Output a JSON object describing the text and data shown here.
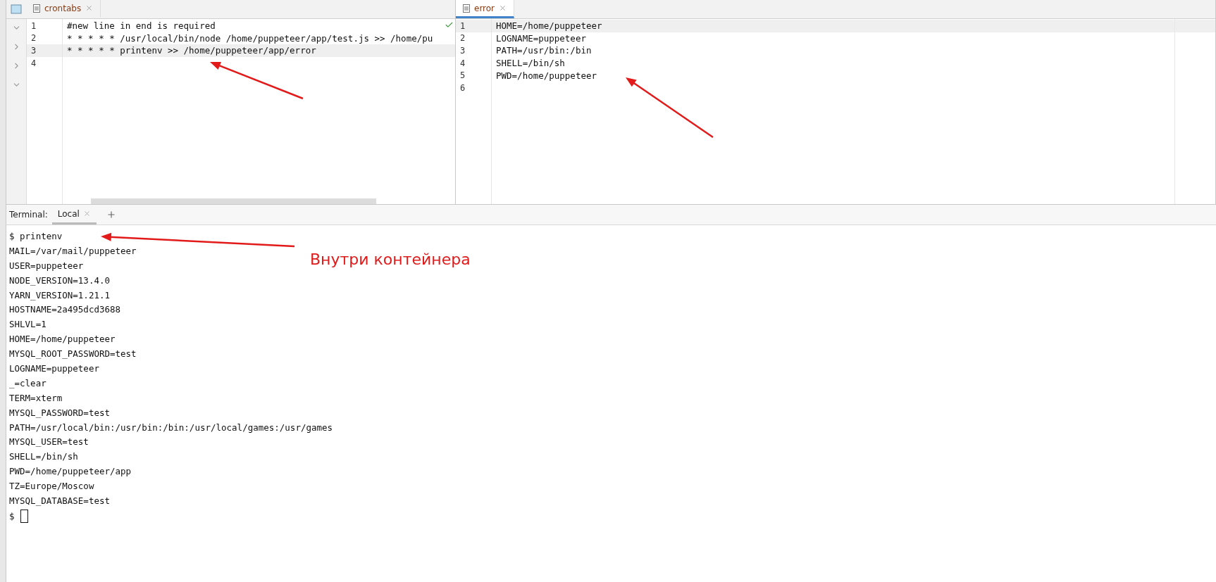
{
  "editors": [
    {
      "tab": {
        "label": "crontabs",
        "selected": false
      },
      "status_ok": true,
      "lines": [
        {
          "number": "1",
          "text": "#new line in end is required",
          "current": false
        },
        {
          "number": "2",
          "text": "* * * * * /usr/local/bin/node /home/puppeteer/app/test.js >> /home/pu",
          "current": false
        },
        {
          "number": "3",
          "text": "* * * * * printenv >> /home/puppeteer/app/error",
          "current": true
        },
        {
          "number": "4",
          "current": false
        }
      ]
    },
    {
      "tab": {
        "label": "error",
        "selected": true
      },
      "status_ok": false,
      "lines": [
        {
          "number": "1",
          "text": "HOME=/home/puppeteer",
          "current": true
        },
        {
          "number": "2",
          "text": "LOGNAME=puppeteer",
          "current": false
        },
        {
          "number": "3",
          "text": "PATH=/usr/bin:/bin",
          "current": false
        },
        {
          "number": "4",
          "text": "SHELL=/bin/sh",
          "current": false
        },
        {
          "number": "5",
          "text": "PWD=/home/puppeteer",
          "current": false
        },
        {
          "number": "6",
          "current": false
        }
      ]
    }
  ],
  "terminal": {
    "title": "Terminal:",
    "tabs": [
      {
        "label": "Local",
        "selected": true
      }
    ],
    "lines": [
      "$ printenv",
      "MAIL=/var/mail/puppeteer",
      "USER=puppeteer",
      "NODE_VERSION=13.4.0",
      "YARN_VERSION=1.21.1",
      "HOSTNAME=2a495dcd3688",
      "SHLVL=1",
      "HOME=/home/puppeteer",
      "MYSQL_ROOT_PASSWORD=test",
      "LOGNAME=puppeteer",
      "_=clear",
      "TERM=xterm",
      "MYSQL_PASSWORD=test",
      "PATH=/usr/local/bin:/usr/bin:/bin:/usr/local/games:/usr/games",
      "MYSQL_USER=test",
      "SHELL=/bin/sh",
      "PWD=/home/puppeteer/app",
      "TZ=Europe/Moscow",
      "MYSQL_DATABASE=test"
    ],
    "prompt": "$"
  },
  "annotation": {
    "text": "Внутри контейнера"
  }
}
